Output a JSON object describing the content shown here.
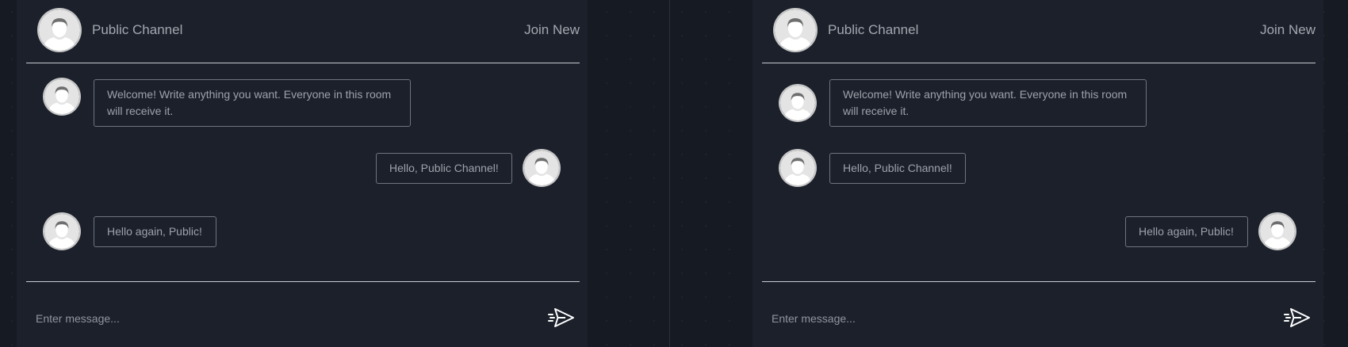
{
  "panels": [
    {
      "header": {
        "channel_name": "Public Channel",
        "join_label": "Join New"
      },
      "messages": [
        {
          "side": "left",
          "text": "Welcome! Write anything you want. Everyone in this room will receive it."
        },
        {
          "side": "right",
          "text": "Hello, Public Channel!"
        },
        {
          "side": "left",
          "text": "Hello again, Public!"
        }
      ],
      "composer": {
        "placeholder": "Enter message..."
      }
    },
    {
      "header": {
        "channel_name": "Public Channel",
        "join_label": "Join New"
      },
      "messages": [
        {
          "side": "left",
          "text": "Welcome! Write anything you want. Everyone in this room will receive it."
        },
        {
          "side": "left",
          "text": "Hello, Public Channel!"
        },
        {
          "side": "right",
          "text": "Hello again, Public!"
        }
      ],
      "composer": {
        "placeholder": "Enter message..."
      }
    }
  ],
  "icons": {
    "avatar": "user-avatar-icon",
    "send": "send-paper-plane-icon"
  }
}
